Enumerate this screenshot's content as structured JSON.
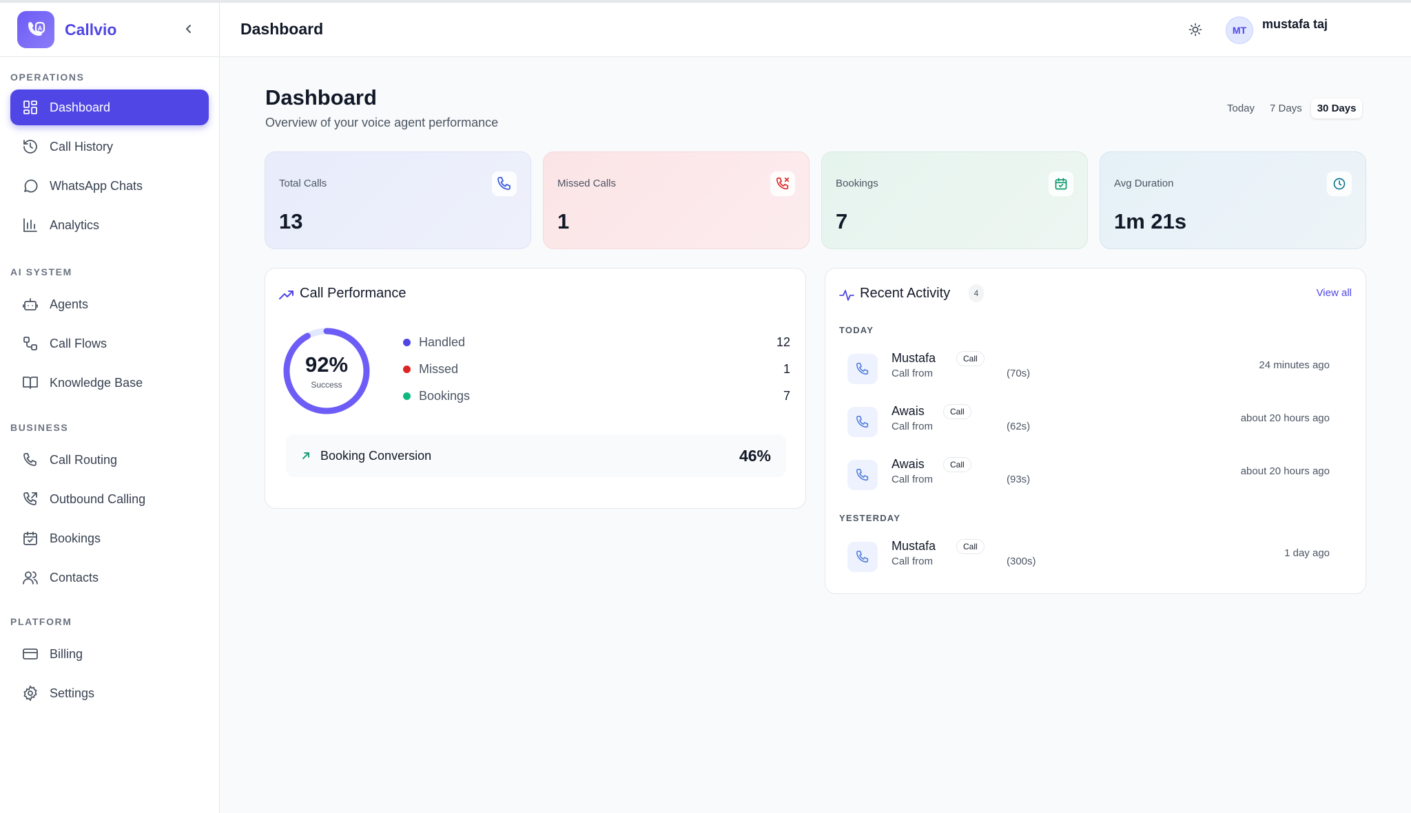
{
  "brand": {
    "name": "Callvio"
  },
  "sidebar": {
    "sections": [
      {
        "label": "OPERATIONS",
        "items": [
          {
            "label": "Dashboard",
            "icon": "dashboard-icon",
            "active": true
          },
          {
            "label": "Call History",
            "icon": "history-icon"
          },
          {
            "label": "WhatsApp Chats",
            "icon": "chat-icon"
          },
          {
            "label": "Analytics",
            "icon": "analytics-icon"
          }
        ]
      },
      {
        "label": "AI SYSTEM",
        "items": [
          {
            "label": "Agents",
            "icon": "robot-icon"
          },
          {
            "label": "Call Flows",
            "icon": "flow-icon"
          },
          {
            "label": "Knowledge Base",
            "icon": "book-icon"
          }
        ]
      },
      {
        "label": "BUSINESS",
        "items": [
          {
            "label": "Call Routing",
            "icon": "phone-icon"
          },
          {
            "label": "Outbound Calling",
            "icon": "outbound-call-icon"
          },
          {
            "label": "Bookings",
            "icon": "calendar-icon"
          },
          {
            "label": "Contacts",
            "icon": "users-icon"
          }
        ]
      },
      {
        "label": "PLATFORM",
        "items": [
          {
            "label": "Billing",
            "icon": "credit-card-icon"
          },
          {
            "label": "Settings",
            "icon": "gear-icon"
          }
        ]
      }
    ]
  },
  "header": {
    "title": "Dashboard",
    "user": {
      "initials": "MT",
      "name": "mustafa taj"
    }
  },
  "main": {
    "title": "Dashboard",
    "subtitle": "Overview of your voice agent performance",
    "ranges": [
      "Today",
      "7 Days",
      "30 Days"
    ],
    "active_range": "30 Days",
    "stats": [
      {
        "label": "Total Calls",
        "value": "13",
        "icon": "phone-icon",
        "color": "#3b5bdb"
      },
      {
        "label": "Missed Calls",
        "value": "1",
        "icon": "phone-missed-icon",
        "color": "#dc2626"
      },
      {
        "label": "Bookings",
        "value": "7",
        "icon": "calendar-check-icon",
        "color": "#059669"
      },
      {
        "label": "Avg Duration",
        "value": "1m 21s",
        "icon": "clock-icon",
        "color": "#0e7490"
      }
    ],
    "performance": {
      "title": "Call Performance",
      "success_pct": "92%",
      "success_label": "Success",
      "success_value": 0.92,
      "legend": [
        {
          "label": "Handled",
          "value": "12",
          "color": "#4f46e5"
        },
        {
          "label": "Missed",
          "value": "1",
          "color": "#dc2626"
        },
        {
          "label": "Bookings",
          "value": "7",
          "color": "#10b981"
        }
      ],
      "conversion_label": "Booking Conversion",
      "conversion_value": "46%"
    },
    "activity": {
      "title": "Recent Activity",
      "count": "4",
      "view_all": "View all",
      "groups": [
        {
          "label": "TODAY",
          "items": [
            {
              "name": "Mustafa",
              "tag": "Call",
              "sub": "Call from",
              "duration": "(70s)",
              "time": "24 minutes ago"
            },
            {
              "name": "Awais",
              "tag": "Call",
              "sub": "Call from",
              "duration": "(62s)",
              "time": "about 20 hours ago"
            },
            {
              "name": "Awais",
              "tag": "Call",
              "sub": "Call from",
              "duration": "(93s)",
              "time": "about 20 hours ago"
            }
          ]
        },
        {
          "label": "YESTERDAY",
          "items": [
            {
              "name": "Mustafa",
              "tag": "Call",
              "sub": "Call from",
              "duration": "(300s)",
              "time": "1 day ago"
            }
          ]
        }
      ]
    }
  },
  "colors": {
    "accent": "#4f46e5"
  }
}
